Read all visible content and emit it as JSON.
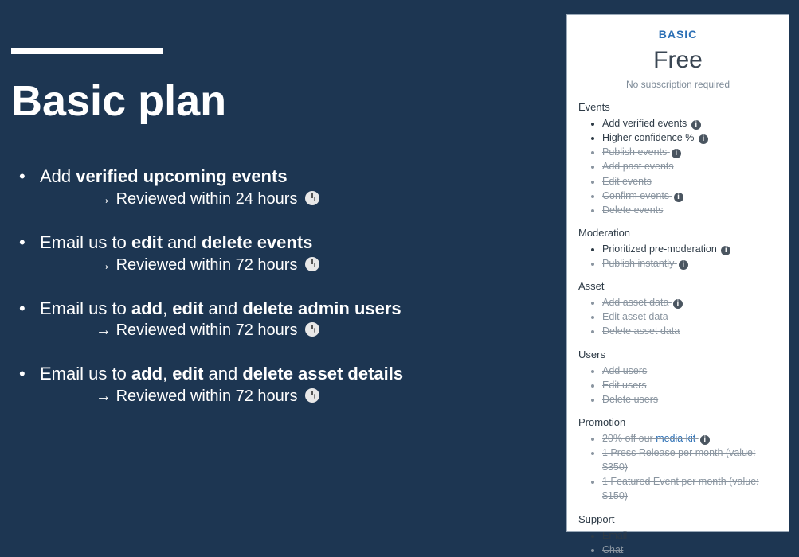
{
  "left": {
    "title": "Basic plan",
    "items": [
      {
        "line_pre": "Add ",
        "line_bold": "verified upcoming events",
        "line_post": "",
        "sub": "Reviewed within 24 hours"
      },
      {
        "line_pre": "Email us to ",
        "line_bold": "edit",
        "line_mid": " and ",
        "line_bold2": "delete events",
        "sub": "Reviewed within 72 hours"
      },
      {
        "line_pre": "Email us to ",
        "line_bold": "add",
        "line_mid": ", ",
        "line_bold2": "edit",
        "line_mid2": " and ",
        "line_bold3": "delete admin users",
        "sub": "Reviewed within 72 hours"
      },
      {
        "line_pre": "Email us to ",
        "line_bold": "add",
        "line_mid": ", ",
        "line_bold2": "edit",
        "line_mid2": " and ",
        "line_bold3": "delete asset details",
        "sub": "Reviewed within 72 hours"
      }
    ]
  },
  "card": {
    "label": "BASIC",
    "price": "Free",
    "note": "No subscription required",
    "sections": [
      {
        "title": "Events",
        "items": [
          {
            "text": "Add verified events",
            "available": true,
            "info": true
          },
          {
            "text": "Higher confidence %",
            "available": true,
            "info": true
          },
          {
            "text": "Publish events",
            "available": false,
            "info": true
          },
          {
            "text": "Add past events",
            "available": false
          },
          {
            "text": "Edit events",
            "available": false
          },
          {
            "text": "Confirm events",
            "available": false,
            "info": true
          },
          {
            "text": "Delete events",
            "available": false
          }
        ]
      },
      {
        "title": "Moderation",
        "items": [
          {
            "text": "Prioritized pre-moderation",
            "available": true,
            "info": true
          },
          {
            "text": "Publish instantly",
            "available": false,
            "info": true
          }
        ]
      },
      {
        "title": "Asset",
        "items": [
          {
            "text": "Add asset data",
            "available": false,
            "info": true
          },
          {
            "text": "Edit asset data",
            "available": false
          },
          {
            "text": "Delete asset data",
            "available": false
          }
        ]
      },
      {
        "title": "Users",
        "items": [
          {
            "text": "Add users",
            "available": false
          },
          {
            "text": "Edit users",
            "available": false
          },
          {
            "text": "Delete users",
            "available": false
          }
        ]
      },
      {
        "title": "Promotion",
        "items": [
          {
            "text_pre": "20% off our ",
            "link": "media kit",
            "available": false,
            "info": true
          },
          {
            "text": "1 Press Release per month (value: $350)",
            "available": false
          },
          {
            "text": "1 Featured Event per month (value: $150)",
            "available": false
          }
        ]
      },
      {
        "title": "Support",
        "items": [
          {
            "text": "Email",
            "available": true
          },
          {
            "text": "Chat",
            "available": false
          }
        ]
      }
    ]
  }
}
